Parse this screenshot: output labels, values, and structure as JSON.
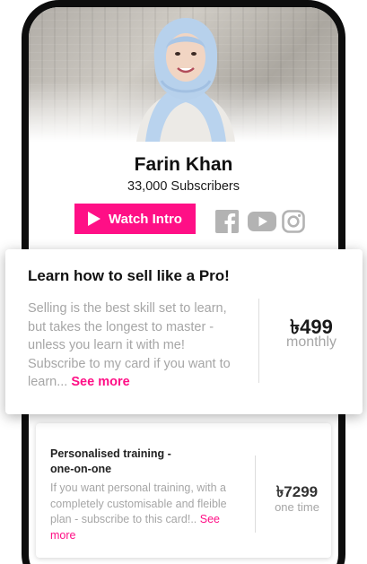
{
  "profile": {
    "name": "Farin Khan",
    "subscribers": "33,000 Subscribers"
  },
  "actions": {
    "watch_intro_label": "Watch Intro"
  },
  "social": {
    "icons": [
      "facebook-icon",
      "youtube-icon",
      "instagram-icon"
    ]
  },
  "cards": [
    {
      "title": "Learn how to sell like a Pro!",
      "body": "Selling is the best skill set to learn, but takes the longest to master - unless you learn it with me! Subscribe to my card if you want to learn...",
      "see_more": "See more",
      "price": "৳499",
      "period": "monthly"
    },
    {
      "title": "Personalised training - one-on-one",
      "body": "If you want personal training, with a completely customisable and fleible plan - subscribe to this card!..",
      "see_more": "See more",
      "price": "৳7299",
      "period": "one time"
    }
  ],
  "colors": {
    "accent": "#ff0f86",
    "frame": "#0d0d0d",
    "muted_text": "#a6a6a6",
    "icon_gray": "#b3b3b3"
  }
}
